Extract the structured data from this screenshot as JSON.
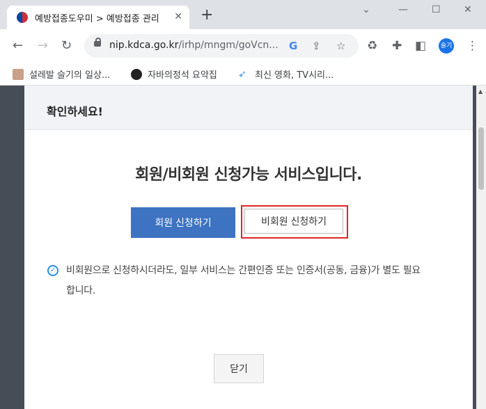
{
  "browser": {
    "tab_title": "예방접종도우미 > 예방접종 관리",
    "url_host": "nip.kdca.go.kr",
    "url_path": "/irhp/mngm/goVcn...",
    "profile_label": "슬기",
    "bookmarks": [
      {
        "label": "설레발 슬기의 일상..."
      },
      {
        "label": "자바의정석 요약집"
      },
      {
        "label": "최신 영화, TV시리..."
      }
    ]
  },
  "modal": {
    "title": "확인하세요!",
    "message": "회원/비회원 신청가능 서비스입니다.",
    "member_button": "회원 신청하기",
    "nonmember_button": "비회원 신청하기",
    "notice": "비회원으로 신청하시더라도, 일부 서비스는 간편인증 또는 인증서(공동, 금융)가 별도 필요합니다.",
    "close_button": "닫기"
  },
  "colors": {
    "primary_button": "#3d73c0",
    "highlight_border": "#e12424",
    "notice_icon": "#2a8fdc"
  }
}
